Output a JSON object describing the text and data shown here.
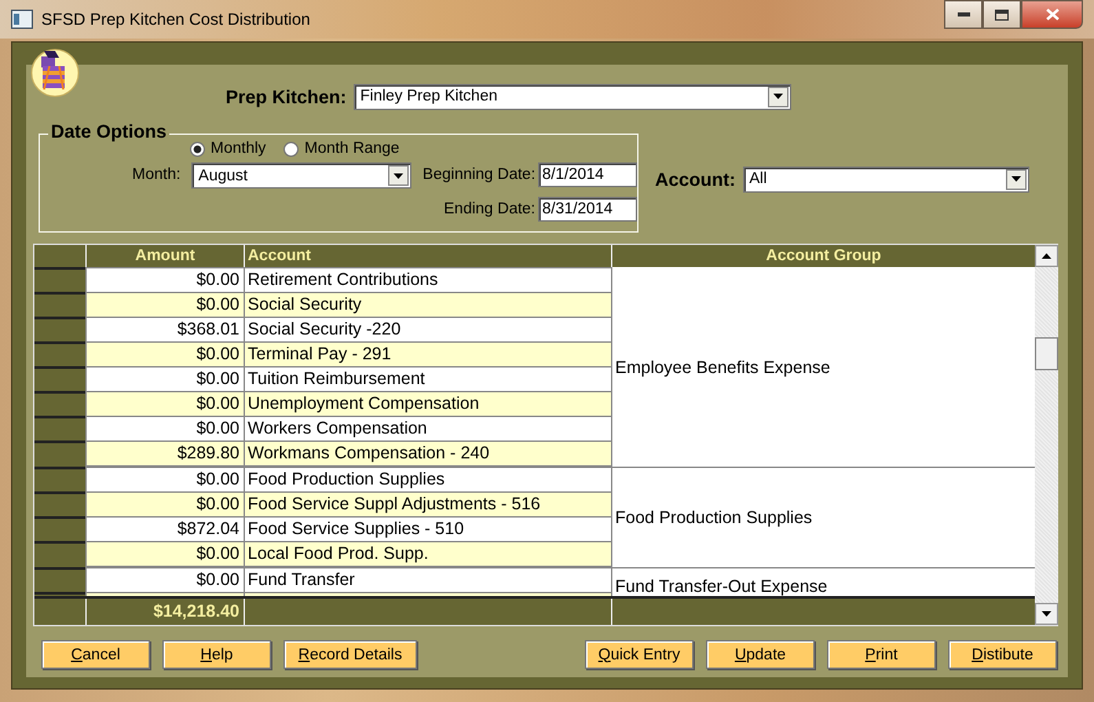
{
  "window": {
    "title": "SFSD Prep Kitchen Cost Distribution"
  },
  "prep_kitchen": {
    "label": "Prep Kitchen:",
    "value": "Finley Prep Kitchen"
  },
  "date_options": {
    "title": "Date Options",
    "modes": [
      {
        "label": "Monthly",
        "selected": true
      },
      {
        "label": "Month Range",
        "selected": false
      }
    ],
    "month": {
      "label": "Month:",
      "value": "August"
    },
    "beginning_date": {
      "label": "Beginning Date:",
      "value": "8/1/2014"
    },
    "ending_date": {
      "label": "Ending Date:",
      "value": "8/31/2014"
    }
  },
  "account": {
    "label": "Account:",
    "value": "All"
  },
  "table": {
    "columns": [
      "Amount",
      "Account",
      "Account Group"
    ],
    "groups": [
      {
        "name": "Employee Benefits Expense",
        "rows": [
          {
            "amount": "$0.00",
            "account": "Retirement Contributions"
          },
          {
            "amount": "$0.00",
            "account": "Social Security"
          },
          {
            "amount": "$368.01",
            "account": "Social Security -220"
          },
          {
            "amount": "$0.00",
            "account": "Terminal Pay - 291"
          },
          {
            "amount": "$0.00",
            "account": "Tuition Reimbursement"
          },
          {
            "amount": "$0.00",
            "account": "Unemployment Compensation"
          },
          {
            "amount": "$0.00",
            "account": "Workers Compensation"
          },
          {
            "amount": "$289.80",
            "account": "Workmans Compensation - 240"
          }
        ]
      },
      {
        "name": "Food Production Supplies",
        "rows": [
          {
            "amount": "$0.00",
            "account": "Food Production Supplies"
          },
          {
            "amount": "$0.00",
            "account": "Food Service Suppl Adjustments - 516"
          },
          {
            "amount": "$872.04",
            "account": "Food Service Supplies - 510"
          },
          {
            "amount": "$0.00",
            "account": "Local Food Prod. Supp."
          }
        ]
      },
      {
        "name": "Fund Transfer-Out Expense",
        "rows": [
          {
            "amount": "$0.00",
            "account": "Fund Transfer"
          }
        ]
      }
    ],
    "total": "$14,218.40"
  },
  "buttons_left": [
    "Cancel",
    "Help",
    "Record Details"
  ],
  "buttons_right": [
    "Quick Entry",
    "Update",
    "Print",
    "Distibute"
  ]
}
